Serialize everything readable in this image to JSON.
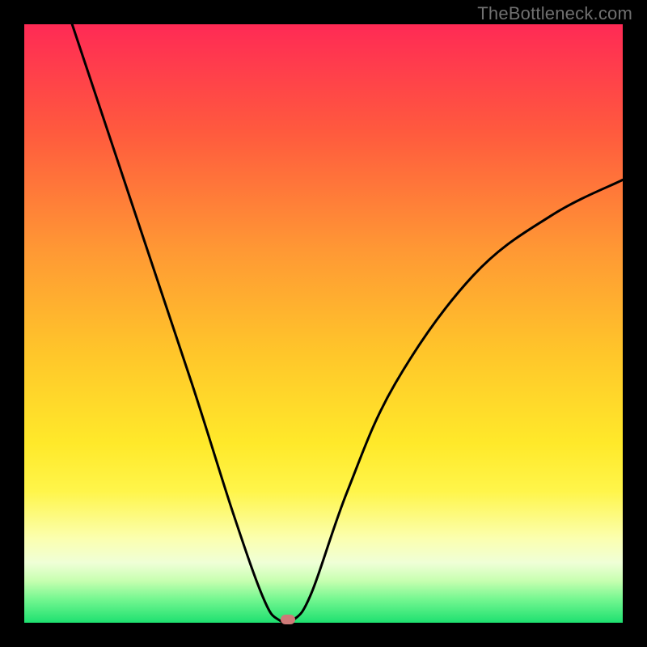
{
  "watermark": "TheBottleneck.com",
  "chart_data": {
    "type": "line",
    "title": "",
    "xlabel": "",
    "ylabel": "",
    "xlim": [
      0,
      100
    ],
    "ylim": [
      0,
      100
    ],
    "grid": false,
    "curve_points": [
      {
        "x": 8,
        "y": 100
      },
      {
        "x": 18,
        "y": 70
      },
      {
        "x": 28,
        "y": 40
      },
      {
        "x": 35,
        "y": 18
      },
      {
        "x": 40,
        "y": 4
      },
      {
        "x": 42.5,
        "y": 0.5
      },
      {
        "x": 45,
        "y": 0.5
      },
      {
        "x": 48,
        "y": 5
      },
      {
        "x": 54,
        "y": 22
      },
      {
        "x": 62,
        "y": 40
      },
      {
        "x": 75,
        "y": 58
      },
      {
        "x": 88,
        "y": 68
      },
      {
        "x": 100,
        "y": 74
      }
    ],
    "marker": {
      "x": 44,
      "y": 0.5
    },
    "marker_color": "#cf7a78",
    "background_gradient": {
      "top": "#ff2a55",
      "mid": "#ffe92a",
      "bottom": "#1ee070"
    }
  }
}
